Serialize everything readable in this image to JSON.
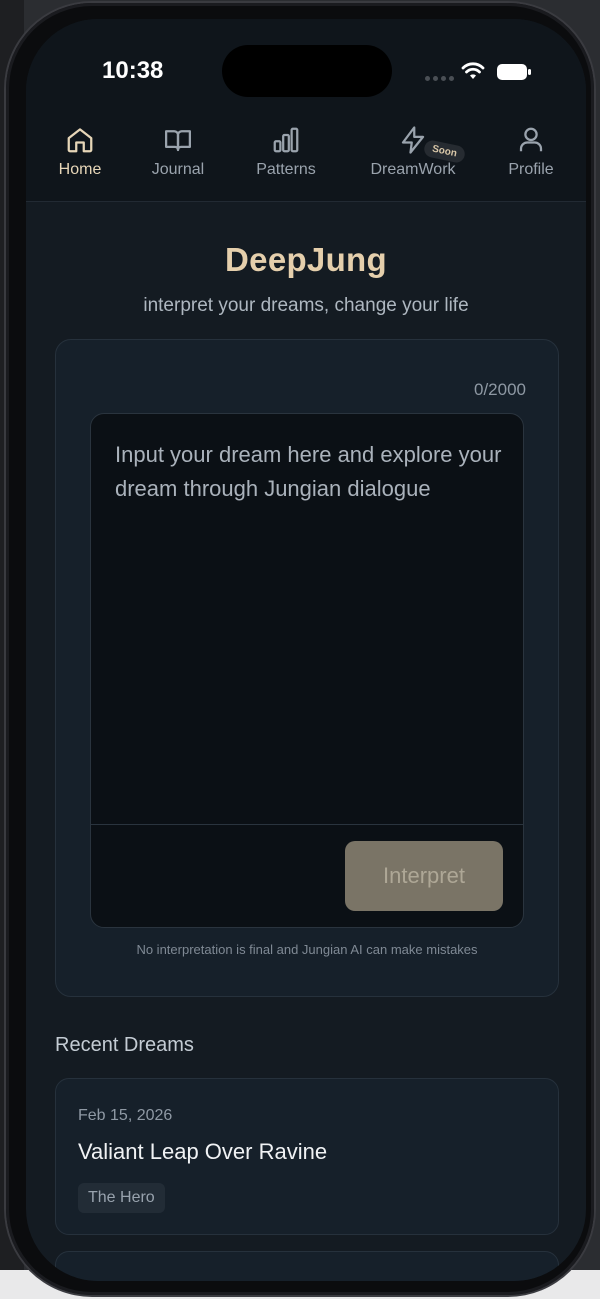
{
  "status_bar": {
    "time": "10:38",
    "icons": [
      "signal-dots-icon",
      "wifi-icon",
      "battery-icon"
    ]
  },
  "tabs": [
    {
      "label": "Home",
      "icon": "home-icon",
      "active": true
    },
    {
      "label": "Journal",
      "icon": "book-icon",
      "active": false
    },
    {
      "label": "Patterns",
      "icon": "bar-chart-icon",
      "active": false
    },
    {
      "label": "DreamWork",
      "icon": "lightning-icon",
      "active": false,
      "badge": "Soon"
    },
    {
      "label": "Profile",
      "icon": "user-icon",
      "active": false
    }
  ],
  "header": {
    "title": "DeepJung",
    "subtitle": "interpret your dreams, change your life"
  },
  "dream_input": {
    "char_count": "0/2000",
    "value": "",
    "placeholder": "Input your dream here and explore your dream through Jungian dialogue",
    "button_label": "Interpret",
    "disclaimer": "No interpretation is final and Jungian AI can make mistakes"
  },
  "recent_dreams": {
    "section_title": "Recent Dreams",
    "items": [
      {
        "date": "Feb 15, 2026",
        "title": "Valiant Leap Over Ravine",
        "tag": "The Hero"
      }
    ]
  },
  "colors": {
    "accent": "#e5cfac",
    "background": "#141b22",
    "card": "#16202a",
    "button": "#7a7466"
  }
}
